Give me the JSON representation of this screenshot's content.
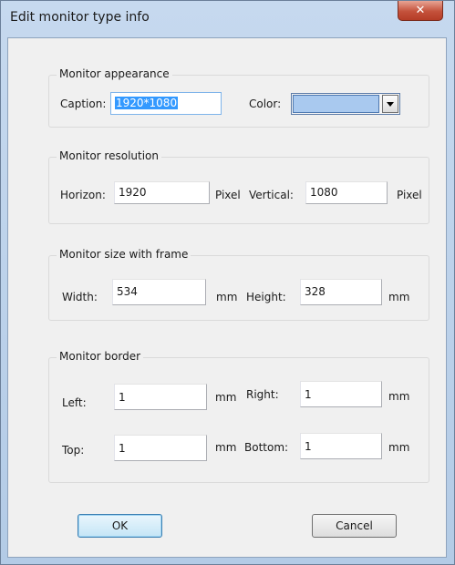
{
  "window": {
    "title": "Edit monitor type info",
    "close_glyph": "✕"
  },
  "appearance": {
    "group_label": "Monitor appearance",
    "caption_label": "Caption:",
    "caption_value": "1920*1080",
    "color_label": "Color:",
    "color_value": "#a9c9ef"
  },
  "resolution": {
    "group_label": "Monitor resolution",
    "horizon_label": "Horizon:",
    "horizon_value": "1920",
    "horizon_unit": "Pixel",
    "vertical_label": "Vertical:",
    "vertical_value": "1080",
    "vertical_unit": "Pixel"
  },
  "size": {
    "group_label": "Monitor size with frame",
    "width_label": "Width:",
    "width_value": "534",
    "width_unit": "mm",
    "height_label": "Height:",
    "height_value": "328",
    "height_unit": "mm"
  },
  "border": {
    "group_label": "Monitor border",
    "left_label": "Left:",
    "left_value": "1",
    "left_unit": "mm",
    "right_label": "Right:",
    "right_value": "1",
    "right_unit": "mm",
    "top_label": "Top:",
    "top_value": "1",
    "top_unit": "mm",
    "bottom_label": "Bottom:",
    "bottom_value": "1",
    "bottom_unit": "mm"
  },
  "buttons": {
    "ok_label": "OK",
    "cancel_label": "Cancel"
  }
}
